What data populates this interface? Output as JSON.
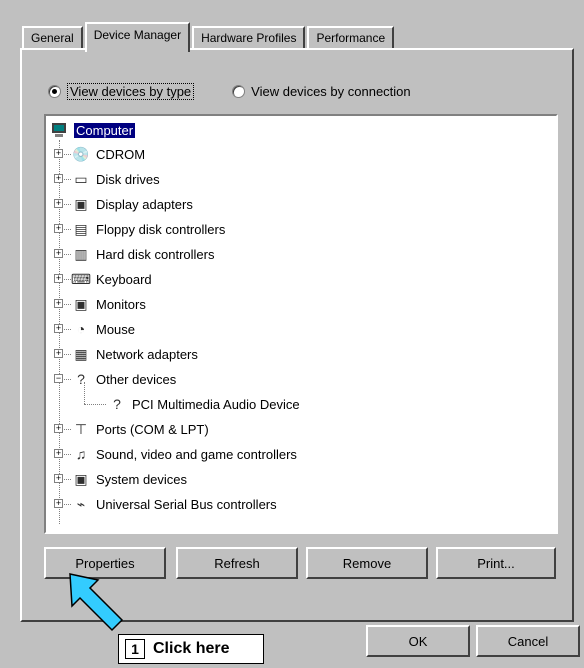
{
  "tabs": [
    {
      "label": "General"
    },
    {
      "label": "Device Manager"
    },
    {
      "label": "Hardware Profiles"
    },
    {
      "label": "Performance"
    }
  ],
  "view": {
    "by_type": "View devices by type",
    "by_connection": "View devices by connection",
    "selected": "by_type"
  },
  "tree": {
    "root": "Computer",
    "items": [
      {
        "label": "CDROM",
        "icon": "cdrom-icon"
      },
      {
        "label": "Disk drives",
        "icon": "disk-drive-icon"
      },
      {
        "label": "Display adapters",
        "icon": "display-adapter-icon"
      },
      {
        "label": "Floppy disk controllers",
        "icon": "floppy-controller-icon"
      },
      {
        "label": "Hard disk controllers",
        "icon": "hard-disk-controller-icon"
      },
      {
        "label": "Keyboard",
        "icon": "keyboard-icon"
      },
      {
        "label": "Monitors",
        "icon": "monitor-icon"
      },
      {
        "label": "Mouse",
        "icon": "mouse-icon"
      },
      {
        "label": "Network adapters",
        "icon": "network-adapter-icon"
      },
      {
        "label": "Other devices",
        "icon": "question-icon"
      },
      {
        "label": "PCI Multimedia Audio Device",
        "icon": "question-icon"
      },
      {
        "label": "Ports (COM & LPT)",
        "icon": "port-icon"
      },
      {
        "label": "Sound, video and game controllers",
        "icon": "sound-icon"
      },
      {
        "label": "System devices",
        "icon": "system-device-icon"
      },
      {
        "label": "Universal Serial Bus controllers",
        "icon": "usb-icon"
      }
    ]
  },
  "buttons": {
    "properties": "Properties",
    "refresh": "Refresh",
    "remove": "Remove",
    "print": "Print...",
    "ok": "OK",
    "cancel": "Cancel"
  },
  "callout": {
    "number": "1",
    "text": "Click here"
  },
  "colors": {
    "face": "#c0c0c0",
    "selection": "#000080",
    "arrow": "#33ccff"
  }
}
